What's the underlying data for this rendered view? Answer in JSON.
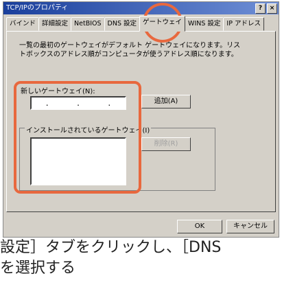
{
  "window": {
    "title": "TCP/IPのプロパティ",
    "help": "?",
    "close": "×"
  },
  "tabs": [
    "バインド",
    "詳細設定",
    "NetBIOS",
    "DNS 設定",
    "ゲートウェイ",
    "WINS 設定",
    "IP アドレス"
  ],
  "description": "一覧の最初のゲートウェイがデフォルト ゲートウェイになります。リストボックスのアドレス順がコンピュータが使うアドレス順になります。",
  "new_gateway_label": "新しいゲートウェイ(N):",
  "ip_dots": [
    ".",
    ".",
    "."
  ],
  "add_button": "追加(A)",
  "installed_group_label": "インストールされているゲートウェイ(I)",
  "remove_button": "削除(R)",
  "ok_button": "OK",
  "cancel_button": "キャンセル",
  "caption_line1": "設定］タブをクリックし、［DNS",
  "caption_line2": "を選択する"
}
